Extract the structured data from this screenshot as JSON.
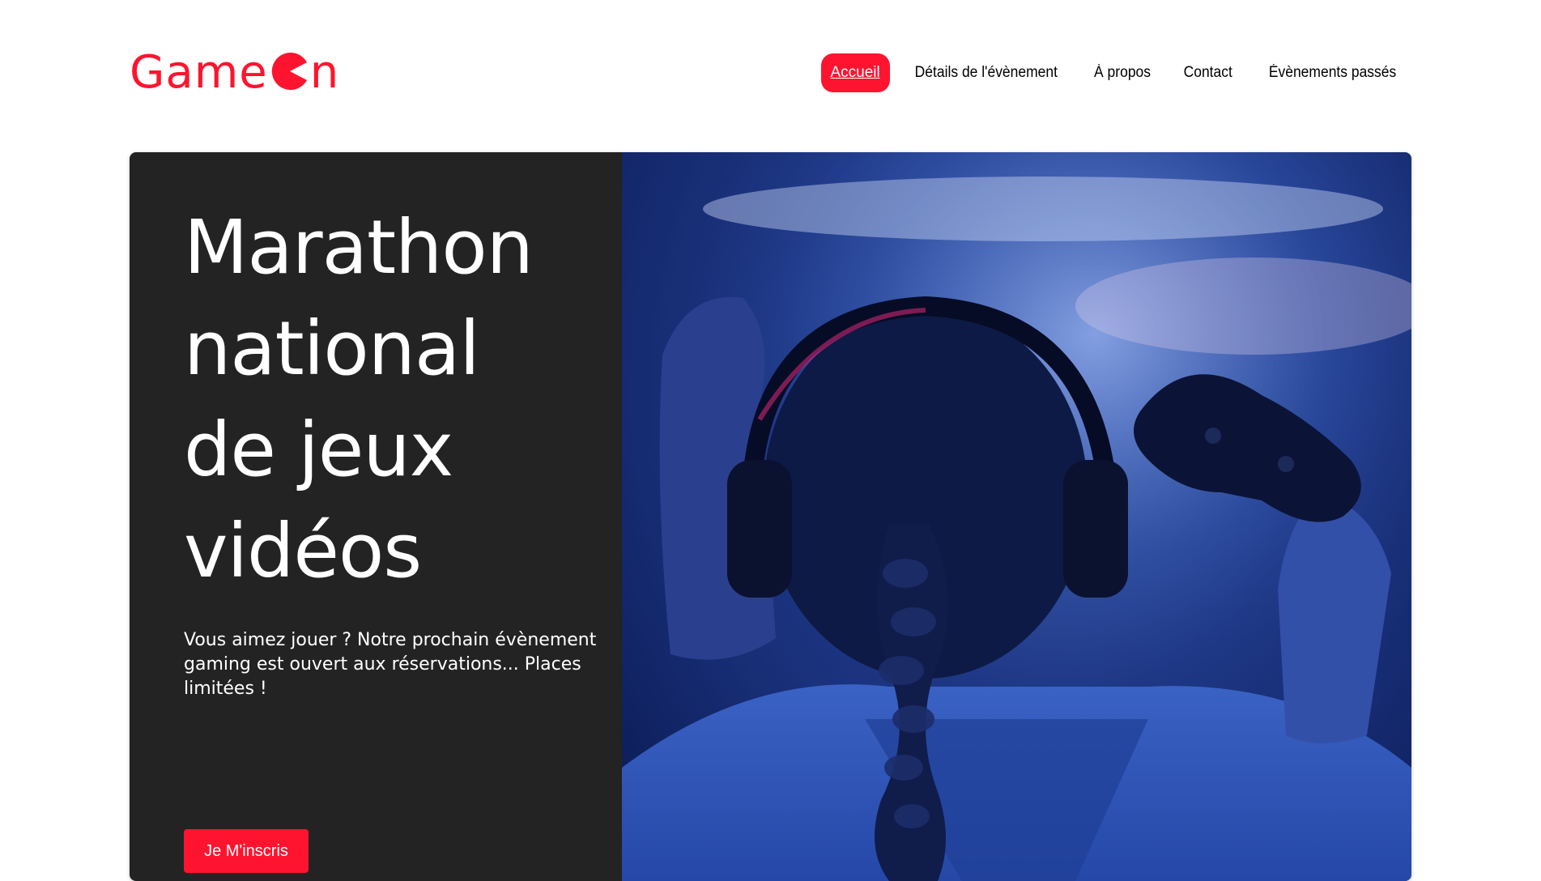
{
  "brand": {
    "logo_text_before": "Game",
    "logo_text_after": "n",
    "color": "#fe142f"
  },
  "nav": {
    "items": [
      {
        "label": "Accueil",
        "active": true
      },
      {
        "label": "Détails de l'évènement",
        "active": false
      },
      {
        "label": "À propos",
        "active": false
      },
      {
        "label": "Contact",
        "active": false
      },
      {
        "label": "Évènements passés",
        "active": false
      }
    ]
  },
  "hero": {
    "title_lines": [
      "Marathon",
      "national",
      "de jeux",
      "vidéos"
    ],
    "description": "Vous aimez jouer ? Notre prochain évènement gaming est ouvert aux réservations... Places limitées !",
    "cta_label": "Je M'inscris",
    "image_icon": "gamer-with-headphones-and-controller-photo"
  },
  "colors": {
    "accent": "#fe142f",
    "hero_panel": "#232323",
    "text_dark": "#000000",
    "text_light": "#ffffff"
  }
}
